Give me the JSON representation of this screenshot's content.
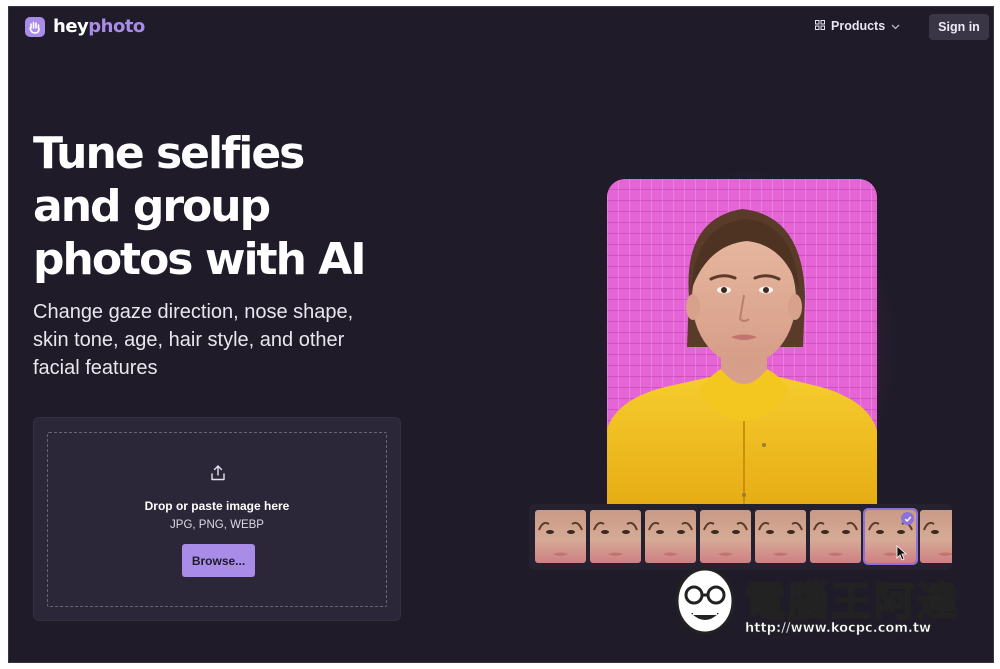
{
  "header": {
    "logo_text_a": "hey",
    "logo_text_b": "photo",
    "products_label": "Products",
    "signin_label": "Sign in"
  },
  "hero": {
    "title_line1": "Tune selfies",
    "title_line2": "and group",
    "title_line3": "photos with AI",
    "subtitle": "Change gaze direction, nose shape, skin tone, age, hair style, and other facial features"
  },
  "upload": {
    "drop_title": "Drop or paste image here",
    "formats": "JPG, PNG, WEBP",
    "browse_label": "Browse..."
  },
  "showcase": {
    "thumbnail_count": 8,
    "selected_index": 6
  },
  "watermark": {
    "text": "電腦王阿達",
    "url": "http://www.kocpc.com.tw"
  },
  "colors": {
    "background": "#1f1b28",
    "accent": "#a98be8",
    "photo_background": "#e564d6",
    "jacket": "#f2c224"
  }
}
